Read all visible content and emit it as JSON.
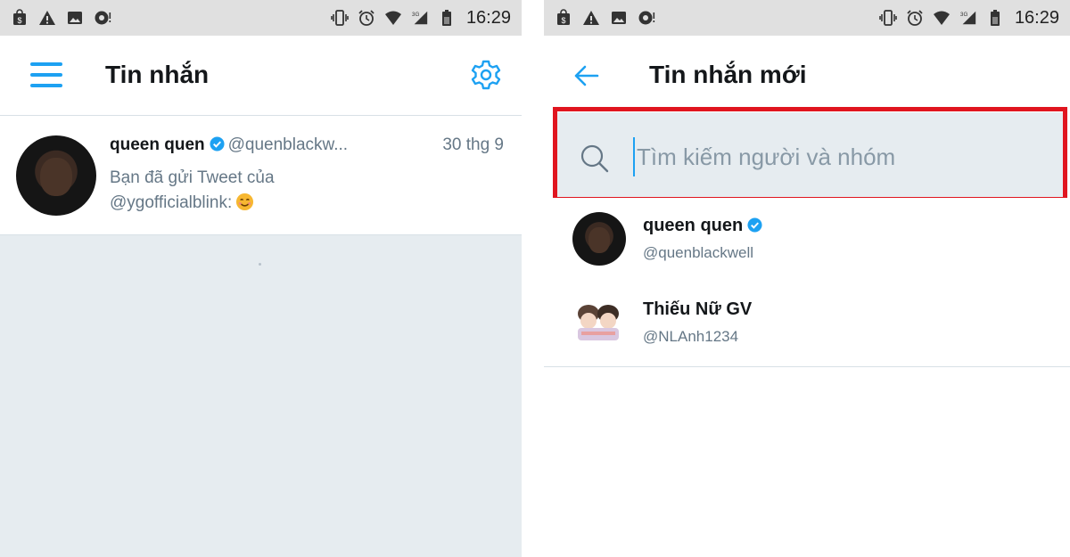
{
  "status_bar": {
    "time": "16:29",
    "network": "3G",
    "icons": [
      "shop-icon",
      "warning-icon",
      "image-icon",
      "record-icon",
      "vibrate-icon",
      "alarm-icon",
      "wifi-icon",
      "signal-icon",
      "battery-icon"
    ]
  },
  "messages_screen": {
    "title": "Tin nhắn",
    "conversations": [
      {
        "name": "queen quen",
        "handle": "@quenblackw...",
        "date": "30 thg 9",
        "preview_line1": "Bạn đã gửi Tweet của",
        "preview_line2": "@ygofficialblink:"
      }
    ]
  },
  "new_message_screen": {
    "title": "Tin nhắn mới",
    "search": {
      "placeholder": "Tìm kiếm người và nhóm",
      "value": ""
    },
    "contacts": [
      {
        "name": "queen quen",
        "handle": "@quenblackwell"
      },
      {
        "name": "Thiếu Nữ GV",
        "handle": "@NLAnh1234"
      }
    ]
  },
  "colors": {
    "accent": "#1da1f2",
    "highlight": "#e0151f",
    "background": "#e6ecf0"
  }
}
